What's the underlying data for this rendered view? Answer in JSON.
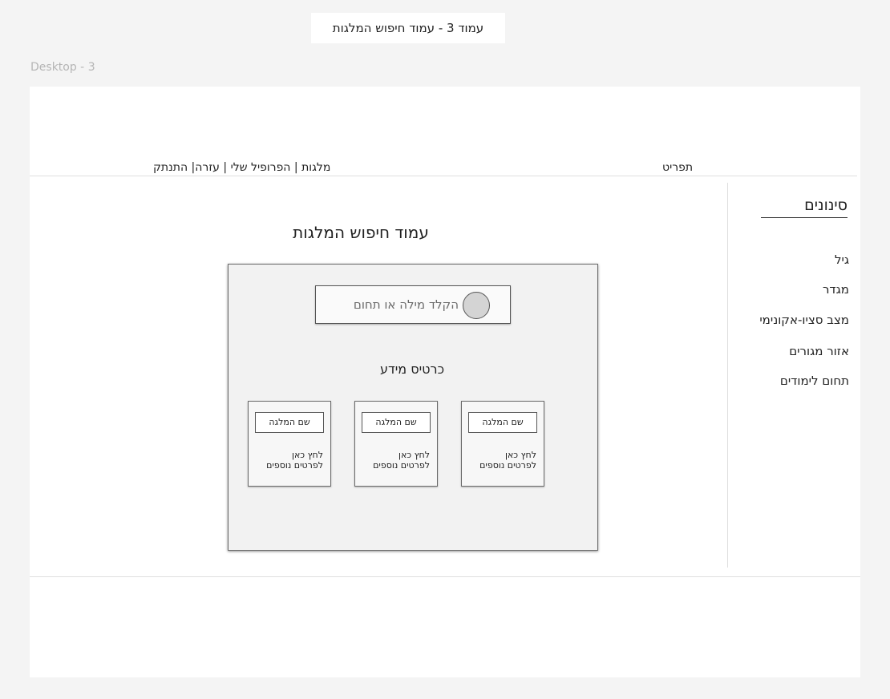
{
  "canvas": {
    "note_label": "עמוד 3 - עמוד חיפוש המלגות",
    "frame_label": "Desktop - 3"
  },
  "header": {
    "nav_links": [
      "מלגות",
      "הפרופיל שלי",
      "עזרה",
      "התנתק"
    ],
    "menu_label": "תפריט"
  },
  "sidebar": {
    "title": "סינונים",
    "filters": [
      "גיל",
      "מגדר",
      "מצב סציו-אקונימי",
      "אזור מגורים",
      "תחום לימודים"
    ]
  },
  "main": {
    "page_title": "עמוד חיפוש המלגות",
    "search": {
      "placeholder": "הקלד מילה או תחום",
      "value": "",
      "icon": "circle-icon"
    },
    "cards_title": "כרטיס מידע",
    "cards": [
      {
        "name": "שם המלגה",
        "link_line1": "לחץ כאן",
        "link_line2": "לפרטים נוספים"
      },
      {
        "name": "שם המלגה",
        "link_line1": "לחץ כאן",
        "link_line2": "לפרטים נוספים"
      },
      {
        "name": "שם המלגה",
        "link_line1": "לחץ כאן",
        "link_line2": "לפרטים נוספים"
      }
    ]
  }
}
